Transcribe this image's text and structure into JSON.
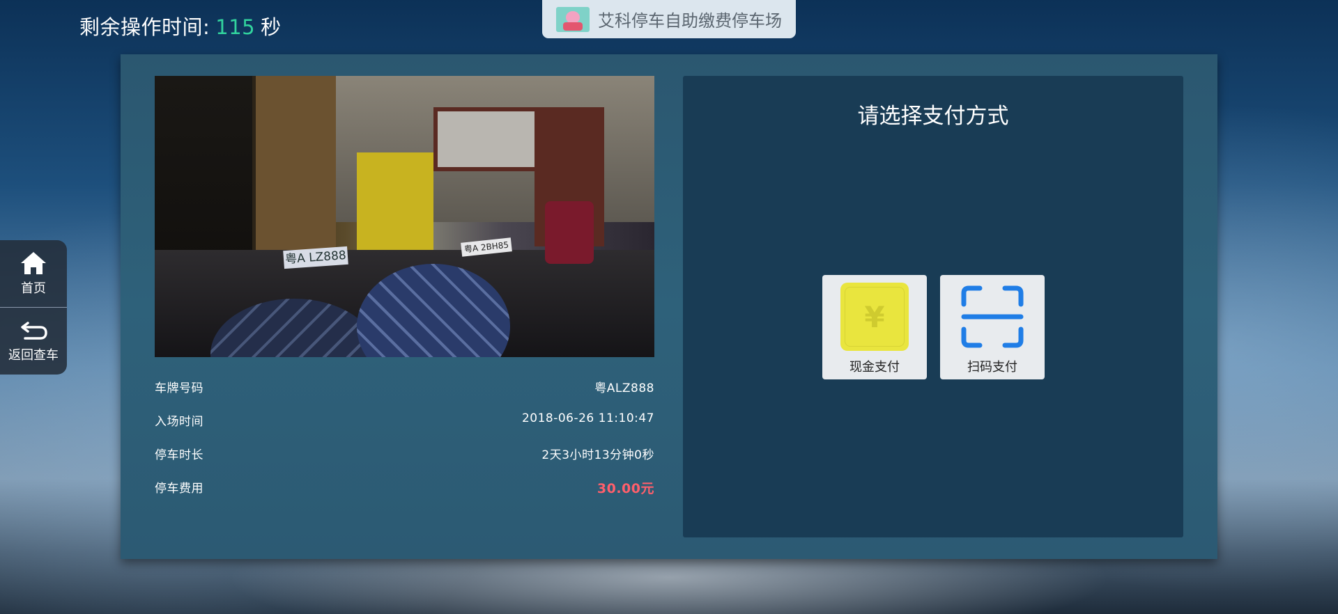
{
  "header": {
    "timer_label": "剩余操作时间:",
    "timer_value": "115",
    "timer_unit": "秒",
    "lot_name": "艾科停车自助缴费停车场"
  },
  "side_nav": {
    "home_label": "首页",
    "back_label": "返回查车"
  },
  "camera": {
    "plate_text": "粤A LZ888",
    "plate2_text": "粤A 2BH85"
  },
  "vehicle_info": {
    "rows": [
      {
        "label": "车牌号码",
        "value": "粤ALZ888"
      },
      {
        "label": "入场时间",
        "value": "2018-06-26 11:10:47"
      },
      {
        "label": "停车时长",
        "value": "2天3小时13分钟0秒"
      },
      {
        "label": "停车费用",
        "value": "30.00元"
      }
    ],
    "fee_color": "#ff5f6b"
  },
  "payment": {
    "title": "请选择支付方式",
    "cash_label": "现金支付",
    "scan_label": "扫码支付",
    "cash_icon": "yen-icon",
    "scan_icon": "scan-icon",
    "scan_color": "#1f7de6"
  },
  "colors": {
    "timer_accent": "#32d49e",
    "panel_bg": "#2e617a",
    "pay_box_bg": "#193c55"
  }
}
